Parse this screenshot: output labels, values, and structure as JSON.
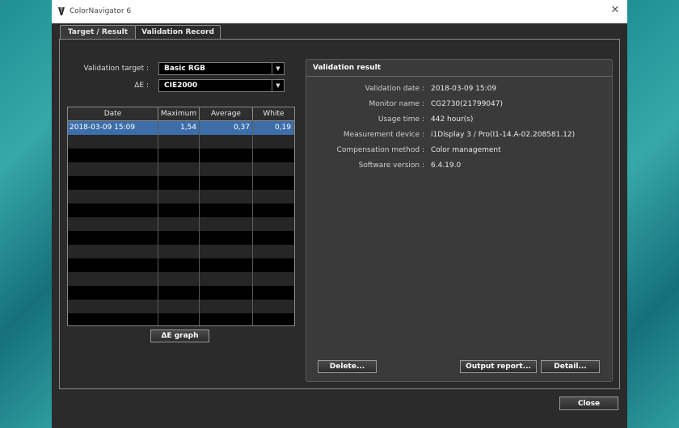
{
  "window": {
    "title": "ColorNavigator 6",
    "close_glyph": "✕"
  },
  "tabs": [
    {
      "label": "Target / Result",
      "active": false
    },
    {
      "label": "Validation Record",
      "active": true
    }
  ],
  "filters": {
    "validation_target_label": "Validation target :",
    "validation_target_value": "Basic RGB",
    "delta_e_label": "ΔE :",
    "delta_e_value": "CIE2000",
    "dropdown_arrow": "▼"
  },
  "table": {
    "columns": [
      "Date",
      "Maximum",
      "Average",
      "White"
    ],
    "rows": [
      {
        "date": "2018-03-09 15:09",
        "maximum": "1,54",
        "average": "0,37",
        "white": "0,19",
        "selected": true
      }
    ]
  },
  "buttons": {
    "delta_e_graph": "ΔE graph",
    "delete": "Delete...",
    "output_report": "Output report...",
    "detail": "Detail...",
    "close": "Close"
  },
  "result": {
    "title": "Validation result",
    "items": [
      {
        "label": "Validation date :",
        "value": "2018-03-09 15:09"
      },
      {
        "label": "Monitor name :",
        "value": "CG2730(21799047)"
      },
      {
        "label": "Usage time :",
        "value": "442 hour(s)"
      },
      {
        "label": "Measurement device :",
        "value": "i1Display 3 / Pro(I1-14.A-02.208581.12)"
      },
      {
        "label": "Compensation method :",
        "value": "Color management"
      },
      {
        "label": "Software version :",
        "value": "6.4.19.0"
      }
    ]
  },
  "colors": {
    "selection": "#3d6ea9",
    "window_bg": "#2b2b2b",
    "desktop": "#2f9d9f"
  },
  "icons": {
    "app": "colornavigator-icon",
    "close": "close-icon",
    "dropdown": "chevron-down-icon"
  }
}
